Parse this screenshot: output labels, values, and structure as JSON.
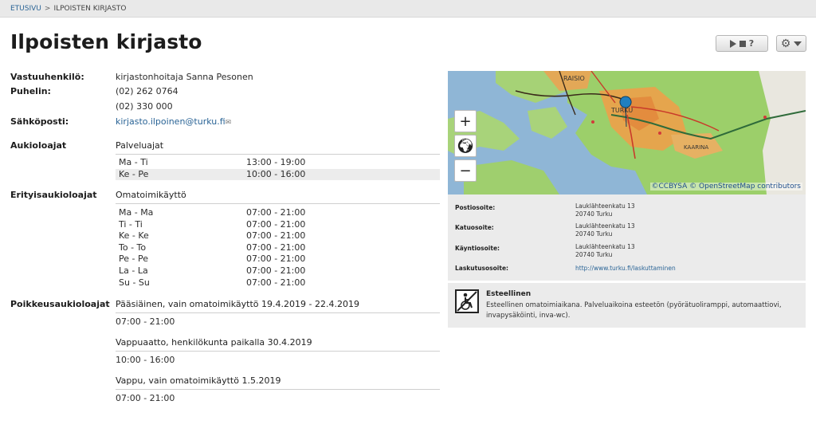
{
  "breadcrumb": {
    "home": "ETUSIVU",
    "separator": ">",
    "current": "ILPOISTEN KIRJASTO"
  },
  "page_title": "Ilpoisten kirjasto",
  "toolbar": {
    "help": "?"
  },
  "info": {
    "contact_label": "Vastuuhenkilö:",
    "contact_value": "kirjastonhoitaja Sanna Pesonen",
    "phone_label": "Puhelin:",
    "phone_1": "(02) 262 0764",
    "phone_2": "(02) 330 000",
    "email_label": "Sähköposti:",
    "email_value": "kirjasto.ilpoinen@turku.fi"
  },
  "opening_hours": {
    "label": "Aukioloajat",
    "heading": "Palveluajat",
    "rows": [
      {
        "day": "Ma - Ti",
        "time": "13:00 - 19:00"
      },
      {
        "day": "Ke - Pe",
        "time": "10:00 - 16:00"
      }
    ]
  },
  "special_hours": {
    "label": "Erityisaukioloajat",
    "heading": "Omatoimikäyttö",
    "rows": [
      {
        "day": "Ma - Ma",
        "time": "07:00 - 21:00"
      },
      {
        "day": "Ti - Ti",
        "time": "07:00 - 21:00"
      },
      {
        "day": "Ke - Ke",
        "time": "07:00 - 21:00"
      },
      {
        "day": "To - To",
        "time": "07:00 - 21:00"
      },
      {
        "day": "Pe - Pe",
        "time": "07:00 - 21:00"
      },
      {
        "day": "La - La",
        "time": "07:00 - 21:00"
      },
      {
        "day": "Su - Su",
        "time": "07:00 - 21:00"
      }
    ]
  },
  "exception_hours": {
    "label": "Poikkeusaukioloajat",
    "items": [
      {
        "title": "Pääsiäinen, vain omatoimikäyttö 19.4.2019 - 22.4.2019",
        "time": "07:00 - 21:00"
      },
      {
        "title": "Vappuaatto, henkilökunta paikalla 30.4.2019",
        "time": "10:00 - 16:00"
      },
      {
        "title": "Vappu, vain omatoimikäyttö 1.5.2019",
        "time": "07:00 - 21:00"
      }
    ]
  },
  "map": {
    "zoom_in": "+",
    "zoom_out": "−",
    "labels": {
      "raisio": "RAISIO",
      "turku": "TURKU",
      "kaarina": "KAARINA"
    },
    "attribution": "©CCBYSA © OpenStreetMap contributors"
  },
  "address": {
    "postal_label": "Postiosoite:",
    "postal_street": "Lauklähteenkatu 13",
    "postal_city": "20740 Turku",
    "street_label": "Katuosoite:",
    "street_street": "Lauklähteenkatu 13",
    "street_city": "20740 Turku",
    "visit_label": "Käyntiosoite:",
    "visit_street": "Lauklähteenkatu 13",
    "visit_city": "20740 Turku",
    "billing_label": "Laskutusosoite:",
    "billing_link": "http://www.turku.fi/laskuttaminen"
  },
  "accessibility": {
    "title": "Esteellinen",
    "text": "Esteellinen omatoimiaikana. Palveluaikoina esteetön (pyörätuoliramppi, automaattiovi, invapysäköinti, inva-wc)."
  }
}
